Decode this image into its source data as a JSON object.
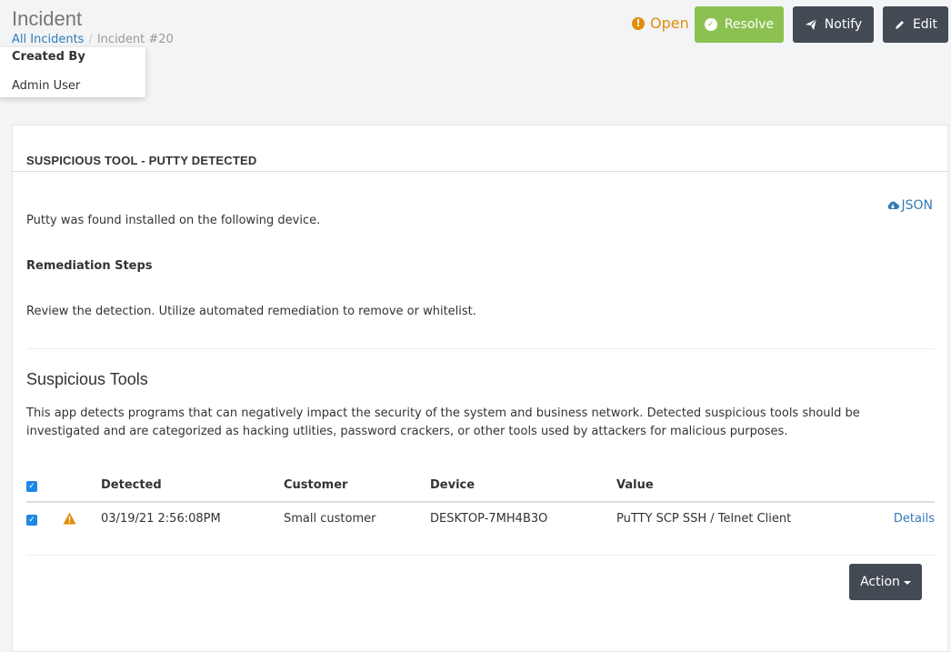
{
  "header": {
    "title": "Incident",
    "breadcrumb": {
      "root": "All Incidents",
      "separator": "/",
      "current": "Incident #20"
    },
    "created_by": {
      "label": "Created By",
      "value": "Admin User"
    },
    "status": "Open",
    "buttons": {
      "resolve": "Resolve",
      "notify": "Notify",
      "edit": "Edit"
    }
  },
  "panel": {
    "title": "SUSPICIOUS TOOL - PUTTY DETECTED",
    "json_link": "JSON",
    "description": "Putty was found installed on the following device.",
    "remediation_title": "Remediation Steps",
    "remediation_text": "Review the detection. Utilize automated remediation to remove or whitelist.",
    "section_title": "Suspicious Tools",
    "section_desc": "This app detects programs that can negatively impact the security of the system and business network. Detected suspicious tools should be investigated and are categorized as hacking utlities, password crackers, or other tools used by attackers for malicious purposes.",
    "table": {
      "headers": {
        "detected": "Detected",
        "customer": "Customer",
        "device": "Device",
        "value": "Value"
      },
      "rows": [
        {
          "detected": "03/19/21 2:56:08PM",
          "customer": "Small customer",
          "device": "DESKTOP-7MH4B3O",
          "value": "PuTTY SCP SSH / Telnet Client",
          "details": "Details"
        }
      ]
    },
    "action_button": "Action"
  },
  "colors": {
    "accent": "#337ab7",
    "resolve": "#8cc152",
    "dark_button": "#434a54",
    "status_warning": "#e08e0b",
    "checkbox": "#1e88e5"
  },
  "icons": {
    "status": "exclamation-circle-icon",
    "resolve": "check-circle-icon",
    "notify": "paper-plane-icon",
    "edit": "pencil-icon",
    "json": "cloud-download-icon",
    "row_warning": "warning-triangle-icon"
  }
}
